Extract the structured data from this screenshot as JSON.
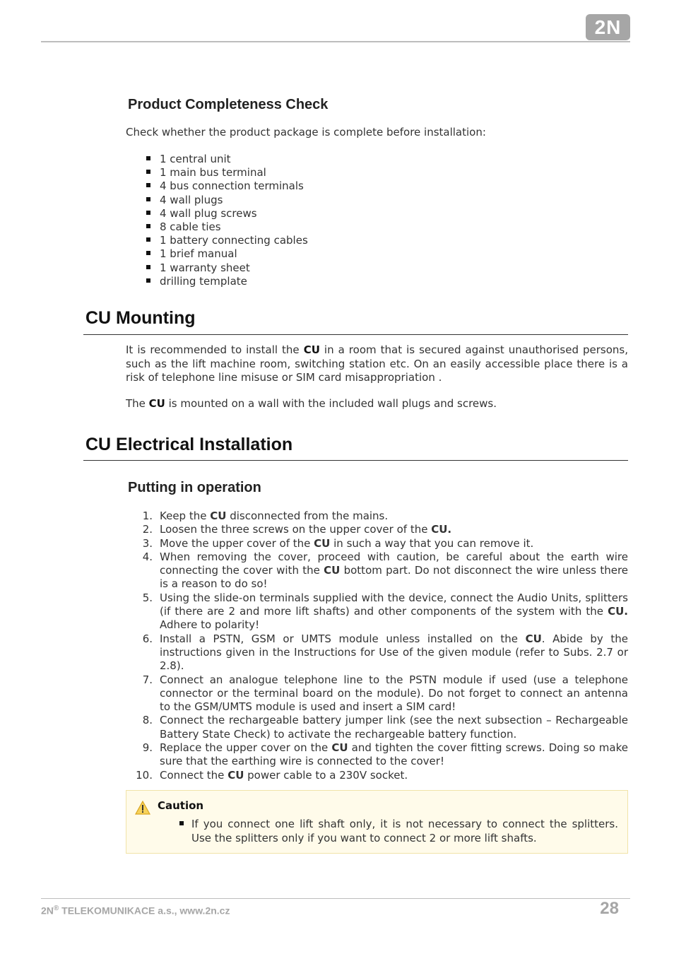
{
  "header": {
    "logo_text": "2N"
  },
  "completeness": {
    "heading": "Product Completeness Check",
    "intro": "Check whether the product package is complete before installation:",
    "items": [
      "1 central unit",
      "1 main bus terminal",
      "4 bus connection terminals",
      "4 wall plugs",
      "4 wall plug screws",
      "8 cable ties",
      "1 battery connecting cables",
      "1 brief manual",
      "1 warranty sheet",
      "drilling template"
    ]
  },
  "mounting": {
    "heading": "CU Mounting",
    "p1": [
      "It is recommended to install the ",
      "CU",
      " in a room that is secured against unauthorised persons, such as the lift machine room, switching station etc. On an easily accessible place there is a risk of telephone line misuse or SIM card misappropriation ."
    ],
    "p2": [
      "The ",
      "CU",
      " is mounted on a wall with the included wall plugs and screws."
    ]
  },
  "electrical": {
    "heading": "CU Electrical Installation",
    "subheading": "Putting in operation",
    "steps": [
      {
        "n": "1.",
        "parts": [
          "Keep the ",
          "CU",
          " disconnected from the mains."
        ]
      },
      {
        "n": "2.",
        "parts": [
          "Loosen the three screws on the upper cover of the ",
          "CU.",
          ""
        ]
      },
      {
        "n": "3.",
        "parts": [
          "Move the upper cover of the ",
          "CU",
          " in such a way that you can remove it."
        ]
      },
      {
        "n": "4.",
        "parts": [
          "When removing the cover, proceed with caution, be careful about the earth wire connecting the cover with the ",
          "CU",
          " bottom part. Do not disconnect the wire unless there is a reason to do so!"
        ]
      },
      {
        "n": "5.",
        "parts": [
          "Using the slide-on terminals supplied with the device, connect the Audio Units, splitters (if there are 2 and more lift shafts) and other components of the system with the ",
          "CU.",
          " Adhere to polarity!"
        ]
      },
      {
        "n": "6.",
        "parts": [
          "Install  a PSTN, GSM or UMTS module unless installed on the ",
          "CU",
          ". Abide by the instructions given in the Instructions for Use of the given module (refer to Subs. 2.7 or 2.8)."
        ]
      },
      {
        "n": "7.",
        "parts": [
          "Connect an analogue telephone line to the PSTN module if used (use a telephone connector or the terminal board on the module). Do not forget to connect an antenna to the GSM/UMTS module is used and insert a SIM card!",
          "",
          ""
        ]
      },
      {
        "n": "8.",
        "parts": [
          "Connect the rechargeable battery jumper link (see the next subsection – Rechargeable Battery State Check) to activate the rechargeable battery function.",
          "",
          ""
        ]
      },
      {
        "n": "9.",
        "parts": [
          "Replace the upper cover on the ",
          "CU",
          " and tighten the cover fitting screws. Doing so make sure that the earthing wire is connected to the cover!"
        ]
      },
      {
        "n": "10.",
        "parts": [
          "Connect the ",
          "CU",
          " power cable to a 230V socket."
        ]
      }
    ],
    "caution": {
      "title": "Caution",
      "icon": "warning-icon",
      "text": "If you connect one lift shaft only, it is not necessary to connect the splitters. Use the splitters only if you want to connect 2 or more lift shafts."
    }
  },
  "footer": {
    "company_prefix": "2N",
    "registered": "®",
    "company_rest": " TELEKOMUNIKACE a.s., www.2n.cz",
    "page_number": "28"
  }
}
